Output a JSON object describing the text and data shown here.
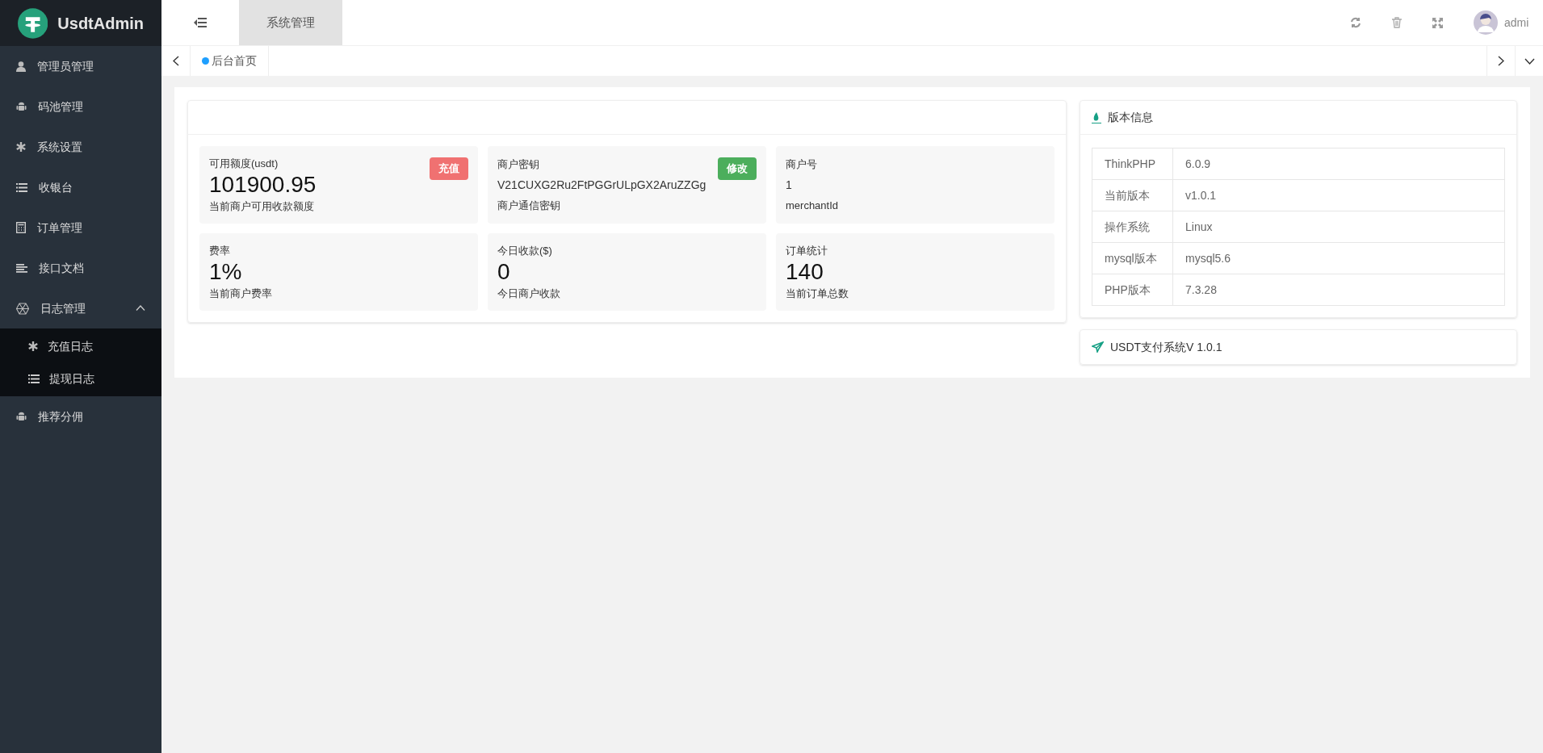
{
  "brand": {
    "name": "UsdtAdmin"
  },
  "sidebar": {
    "items": [
      {
        "label": "管理员管理"
      },
      {
        "label": "码池管理"
      },
      {
        "label": "系统设置"
      },
      {
        "label": "收银台"
      },
      {
        "label": "订单管理"
      },
      {
        "label": "接口文档"
      },
      {
        "label": "日志管理",
        "expanded": true,
        "children": [
          {
            "label": "充值日志"
          },
          {
            "label": "提现日志"
          }
        ]
      },
      {
        "label": "推荐分佣"
      }
    ]
  },
  "top_tabs": [
    {
      "label": "系统管理",
      "selected": true
    }
  ],
  "user": {
    "name": "admi"
  },
  "page_tabs": [
    {
      "label": "后台首页",
      "selected": true
    }
  ],
  "stats": [
    {
      "kind": "number",
      "label": "可用额度(usdt)",
      "value": "101900.95",
      "note": "当前商户可用收款额度",
      "button": {
        "label": "充值",
        "kind": "danger"
      }
    },
    {
      "kind": "text",
      "label": "商户密钥",
      "value": "V21CUXG2Ru2FtPGGrULpGX2AruZZGg",
      "note": "商户通信密钥",
      "button": {
        "label": "修改",
        "kind": "success"
      }
    },
    {
      "kind": "text",
      "label": "商户号",
      "value": "1",
      "note": "merchantId"
    },
    {
      "kind": "number",
      "label": "费率",
      "value": "1%",
      "note": "当前商户费率"
    },
    {
      "kind": "number",
      "label": "今日收款($)",
      "value": "0",
      "note": "今日商户收款"
    },
    {
      "kind": "number",
      "label": "订单统计",
      "value": "140",
      "note": "当前订单总数"
    }
  ],
  "version_info": {
    "title": "版本信息",
    "rows": [
      {
        "name": "ThinkPHP",
        "value": "6.0.9"
      },
      {
        "name": "当前版本",
        "value": "v1.0.1"
      },
      {
        "name": "操作系统",
        "value": "Linux"
      },
      {
        "name": "mysql版本",
        "value": "mysql5.6"
      },
      {
        "name": "PHP版本",
        "value": "7.3.28"
      }
    ]
  },
  "footer_card": {
    "text": "USDT支付系统V 1.0.1"
  }
}
